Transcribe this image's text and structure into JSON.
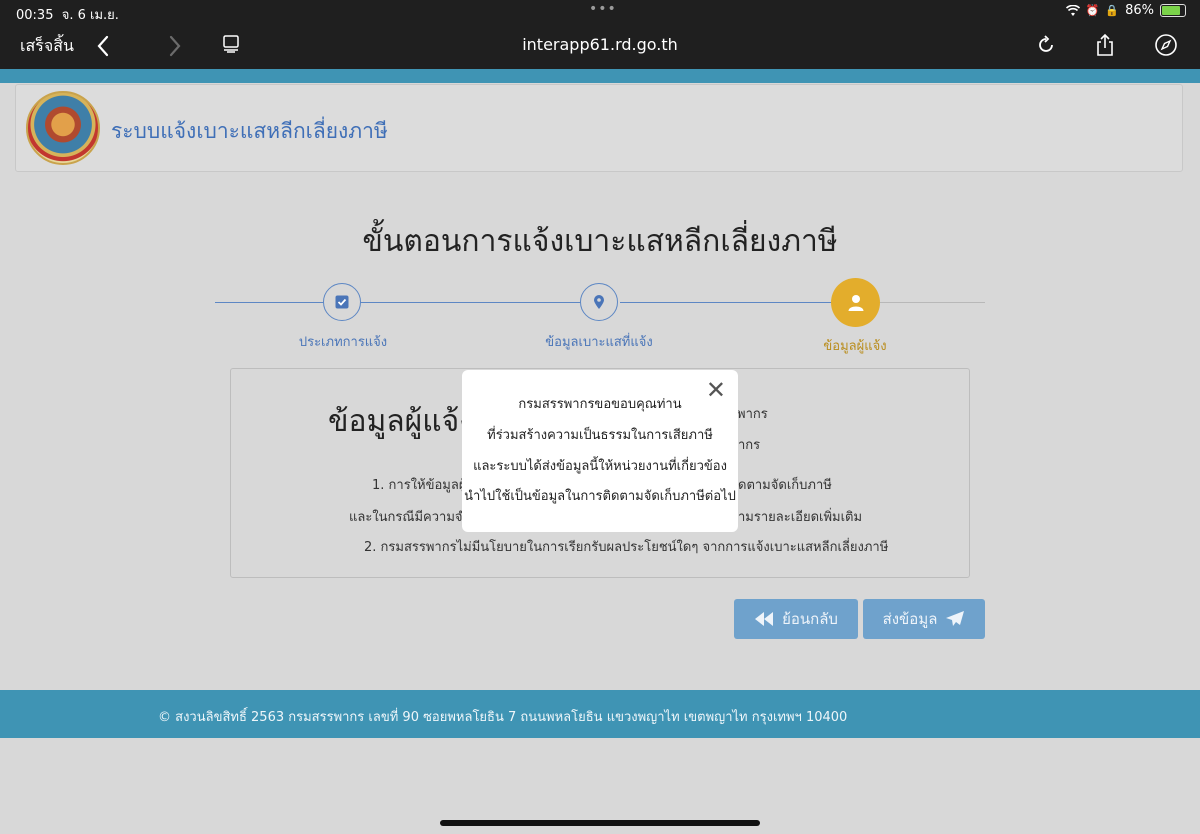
{
  "status_bar": {
    "time": "00:35",
    "date": "จ. 6 เม.ย.",
    "dots": "•••",
    "battery": "86%"
  },
  "browser": {
    "done_label": "เสร็จสิ้น",
    "url": "interapp61.rd.go.th"
  },
  "header": {
    "site_title": "ระบบแจ้งเบาะแสหลีกเลี่ยงภาษี"
  },
  "page": {
    "heading": "ขั้นตอนการแจ้งเบาะแสหลีกเลี่ยงภาษี"
  },
  "steps": [
    {
      "label": "ประเภทการแจ้ง",
      "icon": "check-square-icon"
    },
    {
      "label": "ข้อมูลเบาะแสที่แจ้ง",
      "icon": "map-pin-icon"
    },
    {
      "label": "ข้อมูลผู้แจ้ง",
      "icon": "user-icon"
    }
  ],
  "panel": {
    "title": "ข้อมูลผู้แจ้ง",
    "right_line1": "พากร",
    "right_line2": "ากร",
    "item1_left": "1. การให้ข้อมูลผู้แ",
    "item1_right": "ดตามจัดเก็บภาษี",
    "item1b_left": "และในกรณีมีความจำเป็",
    "item1b_right": "ามรายละเอียดเพิ่มเติม",
    "item2": "2. กรมสรรพากรไม่มีนโยบายในการเรียกรับผลประโยชน์ใดๆ จากการแจ้งเบาะแสหลีกเลี่ยงภาษี"
  },
  "modal": {
    "close": "✕",
    "lines": [
      "กรมสรรพากรขอขอบคุณท่าน",
      "ที่ร่วมสร้างความเป็นธรรมในการเสียภาษี",
      "และระบบได้ส่งข้อมูลนี้ให้หน่วยงานที่เกี่ยวข้อง",
      "นำไปใช้เป็นข้อมูลในการติดตามจัดเก็บภาษีต่อไป"
    ]
  },
  "buttons": {
    "back": "ย้อนกลับ",
    "send": "ส่งข้อมูล"
  },
  "footer": {
    "text": "© สงวนลิขสิทธิ์ 2563 กรมสรรพากร เลขที่ 90 ซอยพหลโยธิน 7 ถนนพหลโยธิน แขวงพญาไท เขตพญาไท กรุงเทพฯ 10400"
  },
  "colors": {
    "accent_teal": "#3f94b4",
    "step_blue": "#5d87c4",
    "active_step": "#e3ad2c",
    "button_blue": "#6fa2cc"
  }
}
